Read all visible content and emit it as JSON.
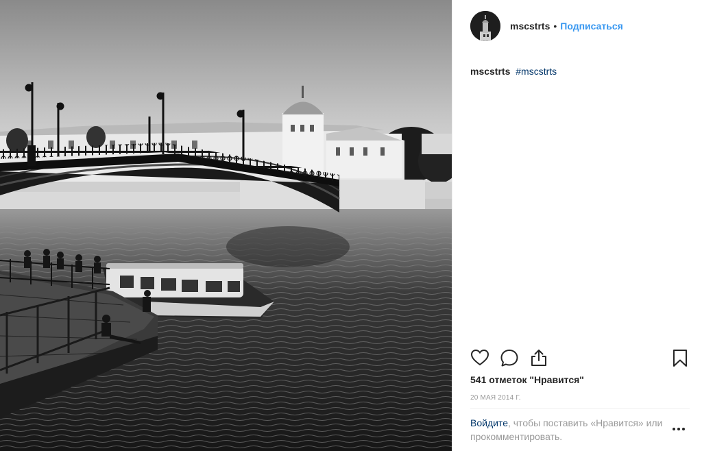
{
  "post": {
    "username": "mscstrts",
    "separator": "•",
    "follow_label": "Подписаться",
    "caption_user": "mscstrts",
    "caption_hashtag": "#mscstrts",
    "likes_text": "541 отметок \"Нравится\"",
    "date_text": "20 МАЯ 2014 Г.",
    "login_link": "Войдите",
    "login_rest": ", чтобы поставить «Нравится» или прокомментировать."
  },
  "icons": {
    "like": "heart-icon",
    "comment": "comment-icon",
    "share": "share-icon",
    "save": "bookmark-icon",
    "more": "more-options-icon"
  },
  "colors": {
    "link_blue": "#3897f0",
    "hashtag_navy": "#003569",
    "muted_gray": "#999999",
    "text": "#262626"
  }
}
